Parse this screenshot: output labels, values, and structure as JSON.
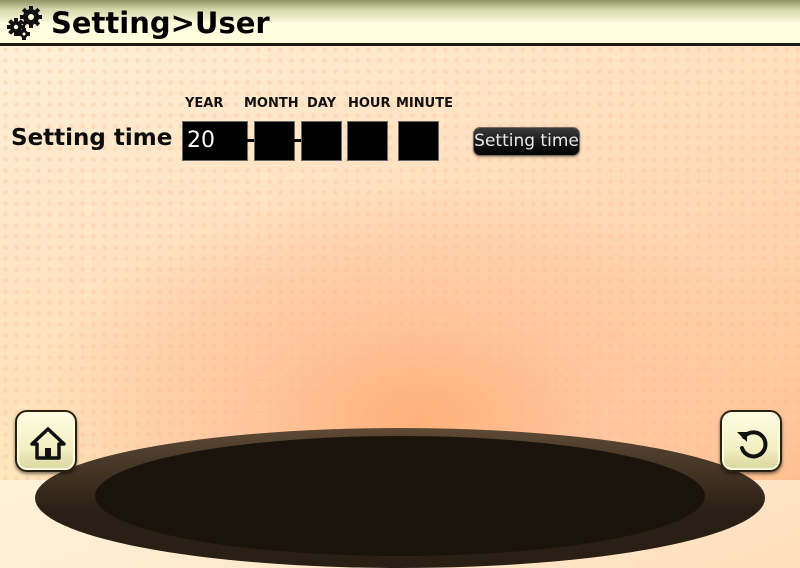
{
  "header": {
    "title": "Setting>User",
    "icon": "gears-icon"
  },
  "time_setting": {
    "label": "Setting time",
    "columns": [
      "YEAR",
      "MONTH",
      "DAY",
      "HOUR",
      "MINUTE"
    ],
    "year_value": "20",
    "month_value": "",
    "day_value": "",
    "hour_value": "",
    "minute_value": "",
    "button_label": "Setting time"
  },
  "footer": {
    "home_icon": "home-icon",
    "back_icon": "return-icon"
  },
  "colors": {
    "header_bg": "#fffddc",
    "field_bg": "#000000",
    "button_bg": "#161616",
    "accent_orange": "#ffb07a"
  }
}
